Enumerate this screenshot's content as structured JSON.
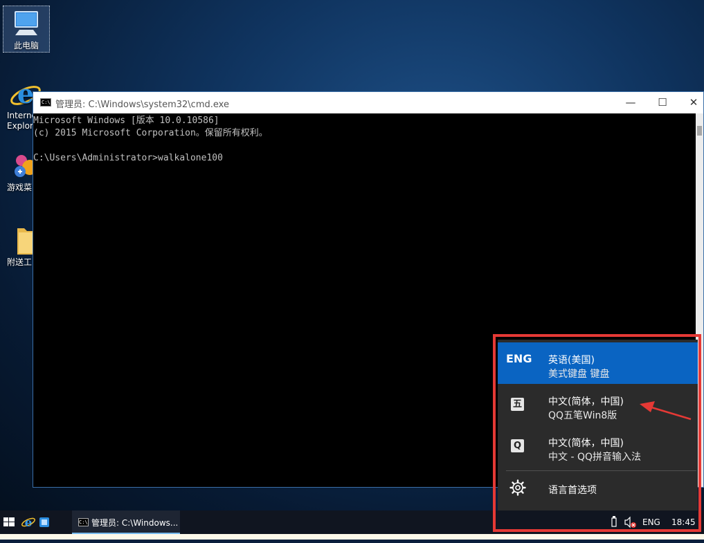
{
  "desktop": {
    "icons": [
      {
        "label": "此电脑",
        "icon": "computer-icon"
      },
      {
        "label": "Interne\nExplore",
        "icon": "ie-icon"
      },
      {
        "label": "游戏菜",
        "icon": "games-icon"
      },
      {
        "label": "附送工",
        "icon": "folder-icon"
      }
    ]
  },
  "cmd_window": {
    "title": "管理员: C:\\Windows\\system32\\cmd.exe",
    "icon_text": "C:\\",
    "lines": [
      "Microsoft Windows [版本 10.0.10586]",
      "(c) 2015 Microsoft Corporation。保留所有权利。",
      "",
      "C:\\Users\\Administrator>walkalone100"
    ],
    "buttons": {
      "minimize": "—",
      "maximize": "☐",
      "close": "✕"
    }
  },
  "language_menu": {
    "items": [
      {
        "code": "ENG",
        "line1": "英语(美国)",
        "line2": "美式键盘 键盘",
        "active": true
      },
      {
        "code": "五",
        "line1": "中文(简体，中国)",
        "line2": "QQ五笔Win8版",
        "active": false
      },
      {
        "code": "Q",
        "line1": "中文(简体，中国)",
        "line2": "中文 - QQ拼音输入法",
        "active": false
      }
    ],
    "preferences_label": "语言首选项"
  },
  "annotation": {
    "highlight_color": "#e53935"
  },
  "taskbar": {
    "cmd_label": "管理员: C:\\Windows...",
    "cmd_icon_text": "C:\\",
    "tray": {
      "language": "ENG",
      "time": "18:45"
    }
  },
  "colors": {
    "accent": "#0a64c2",
    "panel": "#2b2b2b",
    "taskbar": "#101520"
  }
}
